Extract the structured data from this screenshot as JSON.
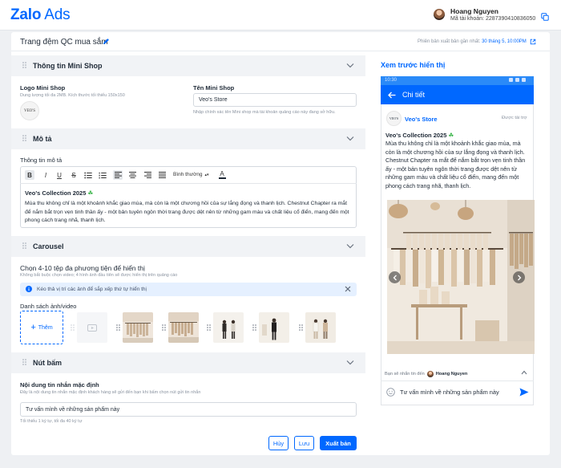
{
  "brand": {
    "logo_bold": "Zalo",
    "logo_light": "Ads",
    "accent": "#0068ff"
  },
  "user": {
    "name": "Hoang Nguyen",
    "account_label": "Mã tài khoản:",
    "account_id": "2287390410836050"
  },
  "page": {
    "title": "Trang đệm QC mua sắm",
    "version_label": "Phiên bản xuất bản gần nhất:",
    "version_date": "30 tháng 5, 10:00PM"
  },
  "sections": {
    "mini_shop": {
      "title": "Thông tin Mini Shop",
      "logo_label": "Logo Mini Shop",
      "logo_hint": "Dung lượng tối đa 2MB. Kích thước tối thiểu 150x150",
      "logo_text": "VEO'S",
      "name_label": "Tên Mini Shop",
      "name_value": "Veo's Store",
      "name_hint": "Nhập chính xác tên Mini shop mà tài khoản quảng cáo này đang sở hữu."
    },
    "description": {
      "title": "Mô tả",
      "field_label": "Thông tin mô tả",
      "toolbar": {
        "bold": "B",
        "italic": "I",
        "underline": "U",
        "strike": "S",
        "paragraph_style": "Bình thường",
        "text_color": "A"
      },
      "heading": "Veo's Collection 2025",
      "body": "Mùa thu không chỉ là một khoảnh khắc giao mùa, mà còn là một chương hồi của sự lắng đọng và thanh lịch. Chestnut Chapter ra mắt để nắm bắt trọn vẹn tinh thần ấy - một bản tuyên ngôn thời trang được dệt nên từ những gam màu và chất liệu cổ điển, mang đến một phong cách trang nhã, thanh lịch."
    },
    "carousel": {
      "title": "Carousel",
      "heading": "Chọn 4-10 tệp đa phương tiện để hiển thị",
      "hint": "Không bắt buộc chọn video; 4 hình ảnh đầu tiên sẽ được hiển thị trên quảng cáo",
      "info": "Kéo thả vị trí các ảnh để sắp xếp thứ tự hiển thị",
      "list_label": "Danh sách ảnh/video",
      "add_label": "Thêm"
    },
    "button": {
      "title": "Nút bấm",
      "field_label": "Nội dung tin nhắn mặc định",
      "field_hint": "Đây là nội dung tin nhắn mặc định khách hàng sẽ gửi đến bạn khi bấm chọn nút gửi tin nhắn",
      "field_value": "Tư vấn mình về những sản phẩm này",
      "counter": "Tối thiểu 1 ký tự, tối đa 40 ký tự"
    }
  },
  "actions": {
    "cancel": "Hủy",
    "save": "Lưu",
    "publish": "Xuất bản"
  },
  "preview": {
    "title": "Xem trước hiển thị",
    "status_time": "10:30",
    "nav_title": "Chi tiết",
    "store_name": "Veo's Store",
    "sponsored": "Được tài trợ",
    "heading": "Veo's Collection 2025",
    "body": "Mùa thu không chỉ là một khoảnh khắc giao mùa, mà còn là một chương hồi của sự lắng đọng và thanh lịch. Chestnut Chapter ra mắt để nắm bắt trọn vẹn tinh thần ấy - một bản tuyên ngôn thời trang được dệt nên từ những gam màu và chất liệu cổ điển, mang đến một phong cách trang nhã, thanh lịch.",
    "from_label": "Bạn sẽ nhắn tin đến",
    "from_name": "Hoang Nguyen",
    "message": "Tư vấn mình về những sản phẩm này"
  }
}
